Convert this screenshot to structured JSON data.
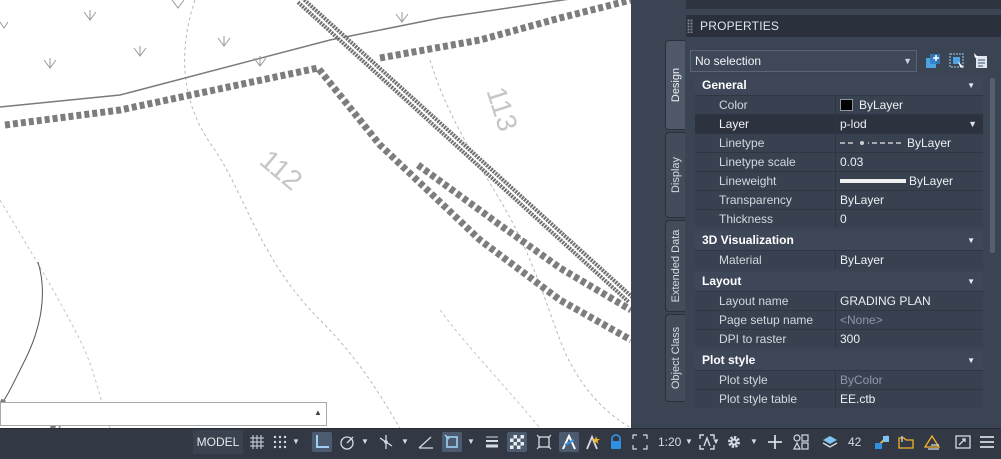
{
  "canvas": {
    "contour_labels": [
      "113",
      "112"
    ],
    "command_line": {
      "value": ""
    }
  },
  "palette": {
    "title": "PROPERTIES",
    "tabs": [
      "Design",
      "Display",
      "Extended Data",
      "Object Class"
    ],
    "active_tab": "Design",
    "selection": "No selection",
    "sections": {
      "general": {
        "title": "General",
        "rows": {
          "color": {
            "name": "Color",
            "value": "ByLayer"
          },
          "layer": {
            "name": "Layer",
            "value": "p-lod"
          },
          "linetype": {
            "name": "Linetype",
            "value": "ByLayer"
          },
          "linetype_scale": {
            "name": "Linetype scale",
            "value": "0.03"
          },
          "lineweight": {
            "name": "Lineweight",
            "value": "ByLayer"
          },
          "transparency": {
            "name": "Transparency",
            "value": "ByLayer"
          },
          "thickness": {
            "name": "Thickness",
            "value": "0"
          }
        }
      },
      "viz3d": {
        "title": "3D Visualization",
        "rows": {
          "material": {
            "name": "Material",
            "value": "ByLayer"
          }
        }
      },
      "layout": {
        "title": "Layout",
        "rows": {
          "layout_name": {
            "name": "Layout name",
            "value": "GRADING PLAN"
          },
          "page_setup": {
            "name": "Page setup name",
            "value": "<None>"
          },
          "dpi": {
            "name": "DPI to raster",
            "value": "300"
          }
        }
      },
      "plot_style": {
        "title": "Plot style",
        "rows": {
          "plot_style": {
            "name": "Plot style",
            "value": "ByColor"
          },
          "plot_style_table": {
            "name": "Plot style table",
            "value": "EE.ctb"
          }
        }
      }
    }
  },
  "statusbar": {
    "model_label": "MODEL",
    "annotation_scale": "1:20",
    "layer_count": "42"
  },
  "colors": {
    "palette_bg": "#3b4453",
    "statusbar_bg": "#323945",
    "active_toggle": "#4d5b70",
    "accent_blue": "#2f8fe0"
  }
}
